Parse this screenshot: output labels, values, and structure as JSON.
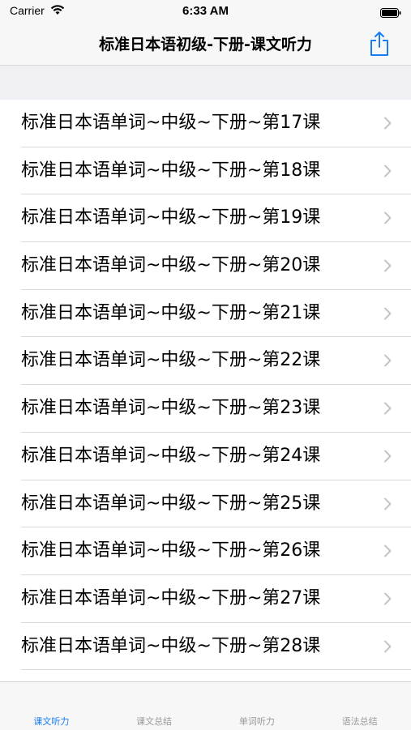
{
  "status_bar": {
    "carrier": "Carrier",
    "time": "6:33 AM"
  },
  "nav": {
    "title": "标准日本语初级-下册-课文听力",
    "share_icon": "share-icon",
    "accent_color": "#1a7cf4"
  },
  "lessons": [
    {
      "label": "标准日本语单词~中级~下册~第17课"
    },
    {
      "label": "标准日本语单词~中级~下册~第18课"
    },
    {
      "label": "标准日本语单词~中级~下册~第19课"
    },
    {
      "label": "标准日本语单词~中级~下册~第20课"
    },
    {
      "label": "标准日本语单词~中级~下册~第21课"
    },
    {
      "label": "标准日本语单词~中级~下册~第22课"
    },
    {
      "label": "标准日本语单词~中级~下册~第23课"
    },
    {
      "label": "标准日本语单词~中级~下册~第24课"
    },
    {
      "label": "标准日本语单词~中级~下册~第25课"
    },
    {
      "label": "标准日本语单词~中级~下册~第26课"
    },
    {
      "label": "标准日本语单词~中级~下册~第27课"
    },
    {
      "label": "标准日本语单词~中级~下册~第28课"
    }
  ],
  "tabs": [
    {
      "label": "课文听力",
      "active": true
    },
    {
      "label": "课文总结",
      "active": false
    },
    {
      "label": "单词听力",
      "active": false
    },
    {
      "label": "语法总结",
      "active": false
    }
  ]
}
